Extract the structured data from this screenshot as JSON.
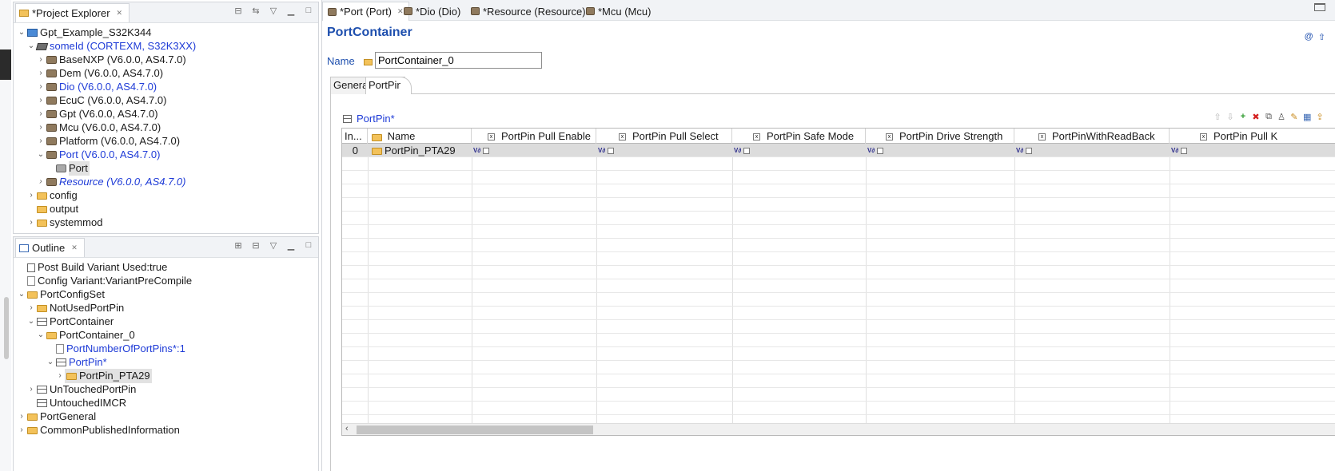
{
  "project_explorer": {
    "title": "*Project Explorer",
    "items": [
      {
        "label": "Gpt_Example_S32K344",
        "style": "normal"
      },
      {
        "label": "someId (CORTEXM, S32K3XX)",
        "style": "blue"
      },
      {
        "label": "BaseNXP (V6.0.0, AS4.7.0)",
        "style": "normal"
      },
      {
        "label": "Dem (V6.0.0, AS4.7.0)",
        "style": "normal"
      },
      {
        "label": "Dio (V6.0.0, AS4.7.0)",
        "style": "blue"
      },
      {
        "label": "EcuC (V6.0.0, AS4.7.0)",
        "style": "normal"
      },
      {
        "label": "Gpt (V6.0.0, AS4.7.0)",
        "style": "normal"
      },
      {
        "label": "Mcu (V6.0.0, AS4.7.0)",
        "style": "normal"
      },
      {
        "label": "Platform (V6.0.0, AS4.7.0)",
        "style": "normal"
      },
      {
        "label": "Port (V6.0.0, AS4.7.0)",
        "style": "blue"
      },
      {
        "label": "Port",
        "style": "selected"
      },
      {
        "label": "Resource (V6.0.0, AS4.7.0)",
        "style": "blue-italic"
      },
      {
        "label": "config",
        "style": "normal"
      },
      {
        "label": "output",
        "style": "normal"
      },
      {
        "label": "systemmod",
        "style": "normal"
      }
    ]
  },
  "outline": {
    "title": "Outline",
    "items": [
      {
        "label": "Post Build Variant Used:true"
      },
      {
        "label": "Config Variant:VariantPreCompile"
      },
      {
        "label": "PortConfigSet"
      },
      {
        "label": "NotUsedPortPin"
      },
      {
        "label": "PortContainer"
      },
      {
        "label": "PortContainer_0"
      },
      {
        "label": "PortNumberOfPortPins*:1"
      },
      {
        "label": "PortPin*"
      },
      {
        "label": "PortPin_PTA29"
      },
      {
        "label": "UnTouchedPortPin"
      },
      {
        "label": "UntouchedIMCR"
      },
      {
        "label": "PortGeneral"
      },
      {
        "label": "CommonPublishedInformation"
      }
    ]
  },
  "editor": {
    "tabs": [
      {
        "label": "*Port (Port)"
      },
      {
        "label": "*Dio (Dio)"
      },
      {
        "label": "*Resource (Resource)"
      },
      {
        "label": "*Mcu (Mcu)"
      }
    ],
    "title": "PortContainer",
    "name_label": "Name",
    "name_value": "PortContainer_0",
    "inner_tabs": [
      "General",
      "PortPin"
    ],
    "section_title": "PortPin*",
    "table": {
      "columns": [
        "In...",
        "Name",
        "PortPin Pull Enable",
        "PortPin Pull Select",
        "PortPin Safe Mode",
        "PortPin Drive Strength",
        "PortPinWithReadBack",
        "PortPin Pull K"
      ],
      "rows": [
        {
          "index": "0",
          "name": "PortPin_PTA29"
        }
      ]
    }
  },
  "colors": {
    "accent_blue": "#1e4fae",
    "link_blue": "#1e3bd7",
    "selection_gray": "#dcdcdc"
  }
}
